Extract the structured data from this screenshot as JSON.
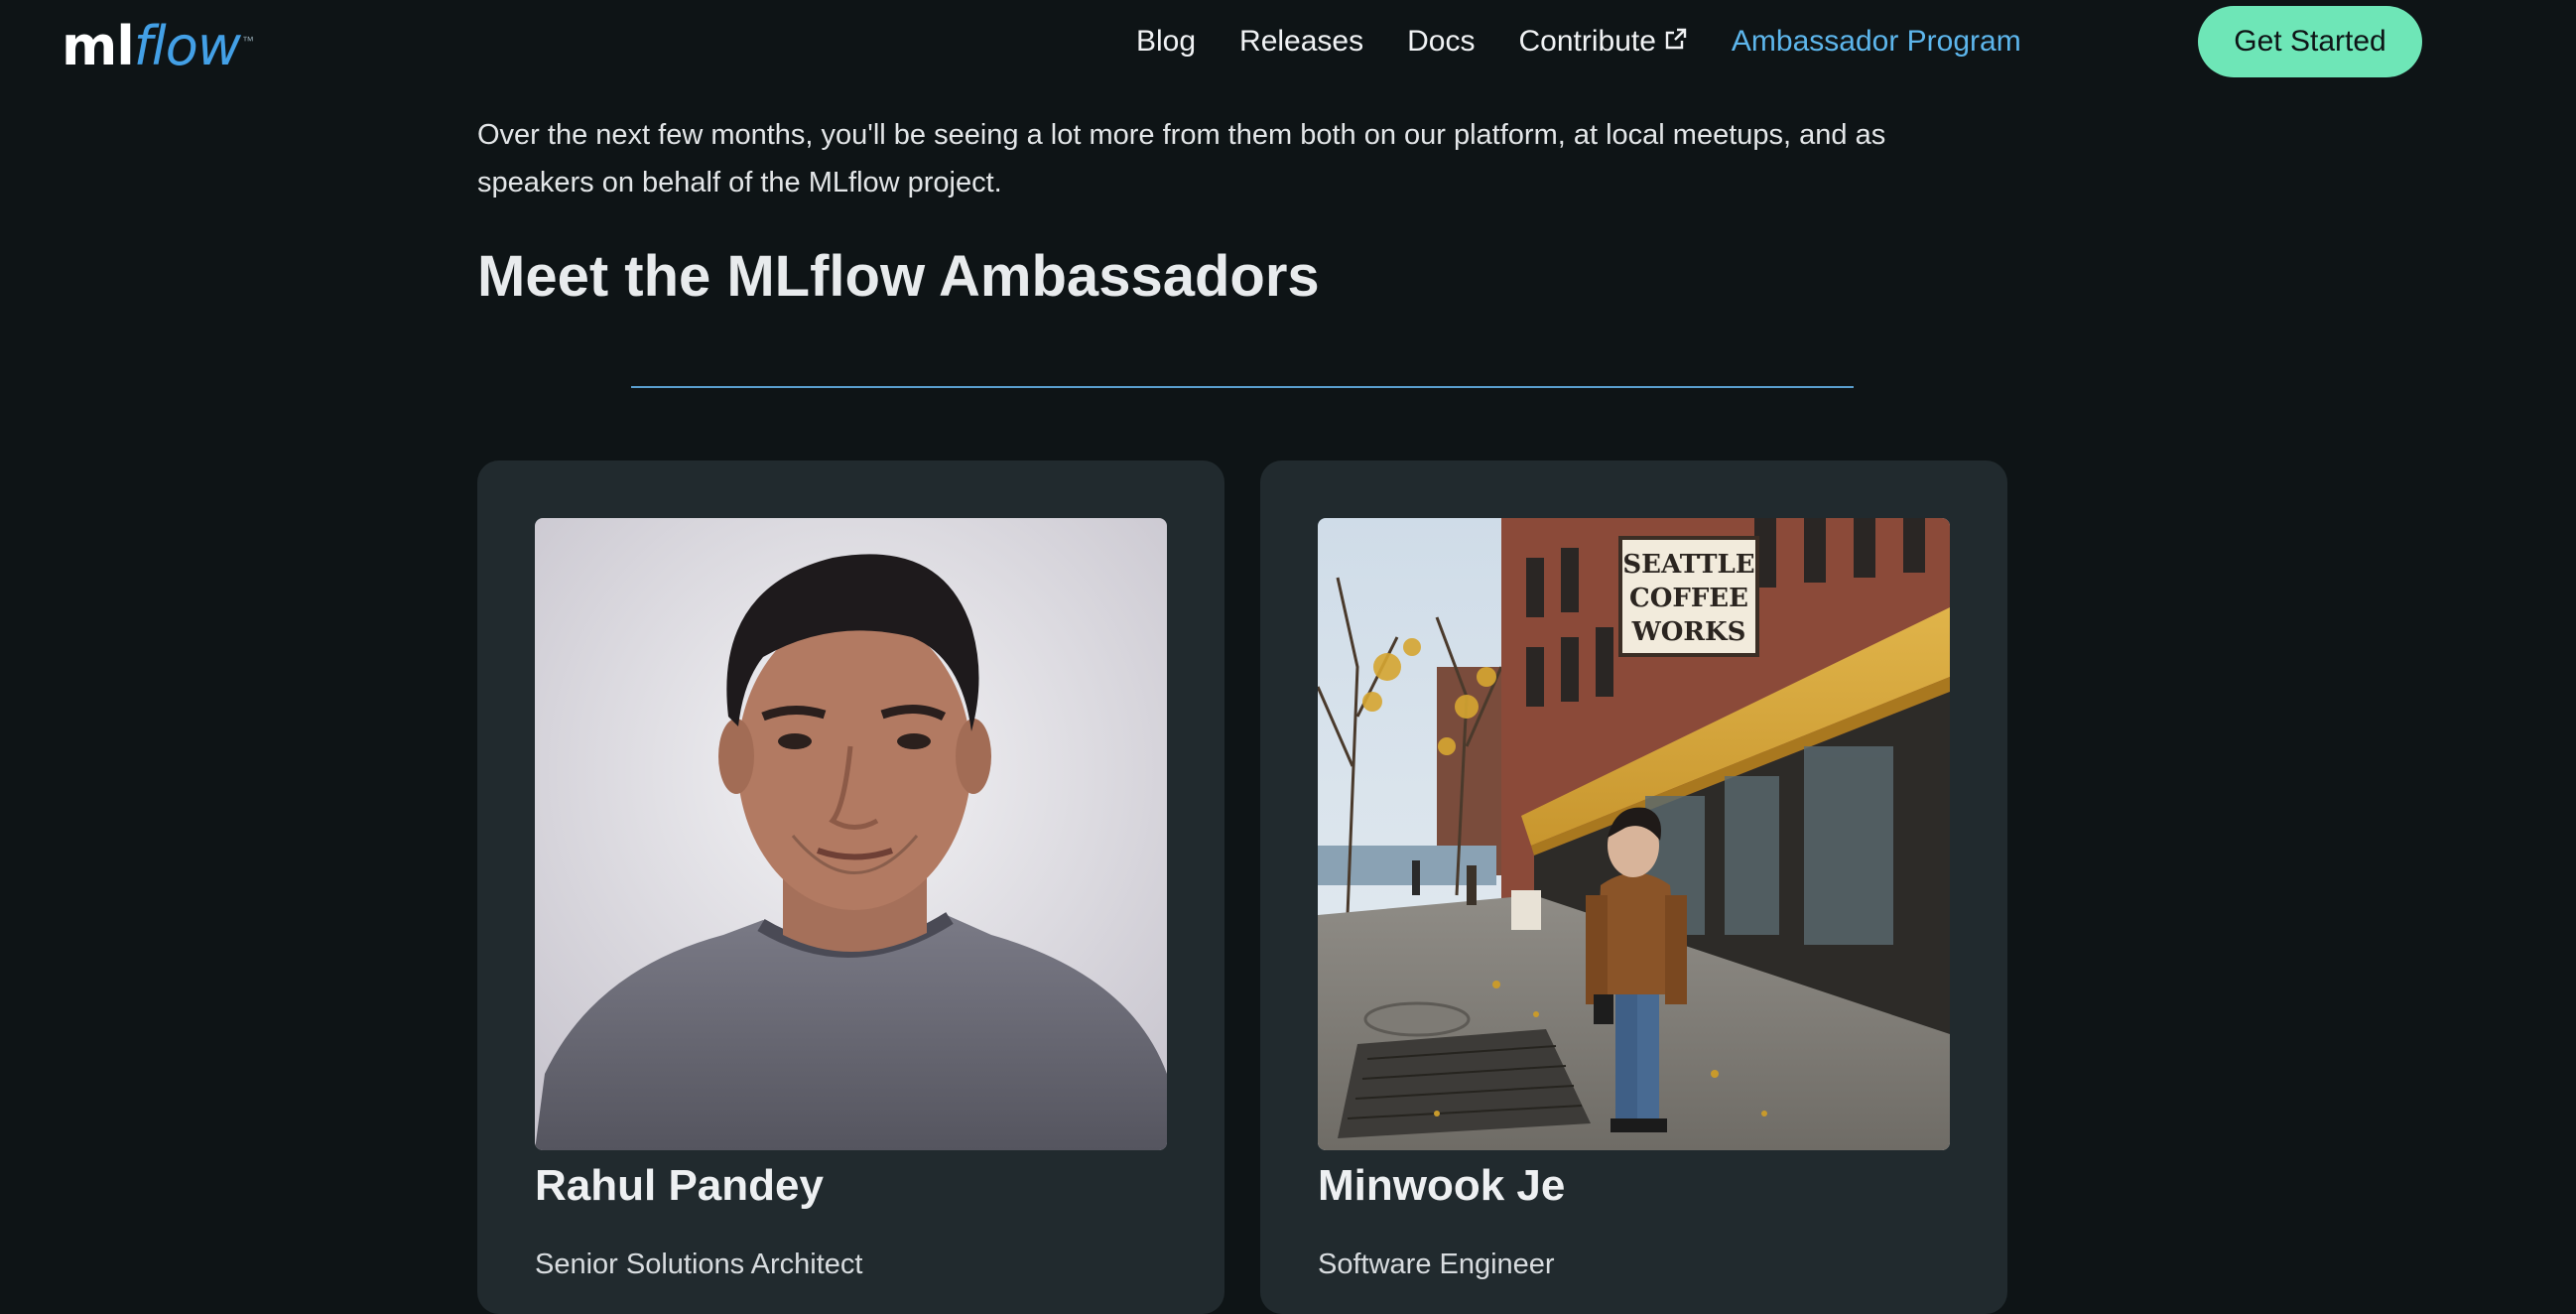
{
  "header": {
    "logo_ml": "ml",
    "logo_flow": "flow",
    "logo_tm": "™",
    "nav": [
      {
        "label": "Blog"
      },
      {
        "label": "Releases"
      },
      {
        "label": "Docs"
      },
      {
        "label": "Contribute",
        "icon": "external-link-icon"
      },
      {
        "label": "Ambassador Program",
        "active": true
      }
    ],
    "cta_label": "Get Started"
  },
  "main": {
    "intro_text": "Over the next few months, you'll be seeing a lot more from them both on our platform, at local meetups, and as speakers on behalf of the MLflow project.",
    "section_title": "Meet the MLflow Ambassadors"
  },
  "ambassadors": [
    {
      "name": "Rahul Pandey",
      "role": "Senior Solutions Architect"
    },
    {
      "name": "Minwook Je",
      "role": "Software Engineer",
      "photo_sign_text": [
        "SEATTLE",
        "COFFEE",
        "WORKS"
      ]
    }
  ],
  "colors": {
    "background": "#0e1416",
    "card": "#212a2e",
    "accent_link": "#5db6ec",
    "cta": "#6ee6b7",
    "divider": "#5a9fcf",
    "logo_flow": "#43a0e6"
  }
}
